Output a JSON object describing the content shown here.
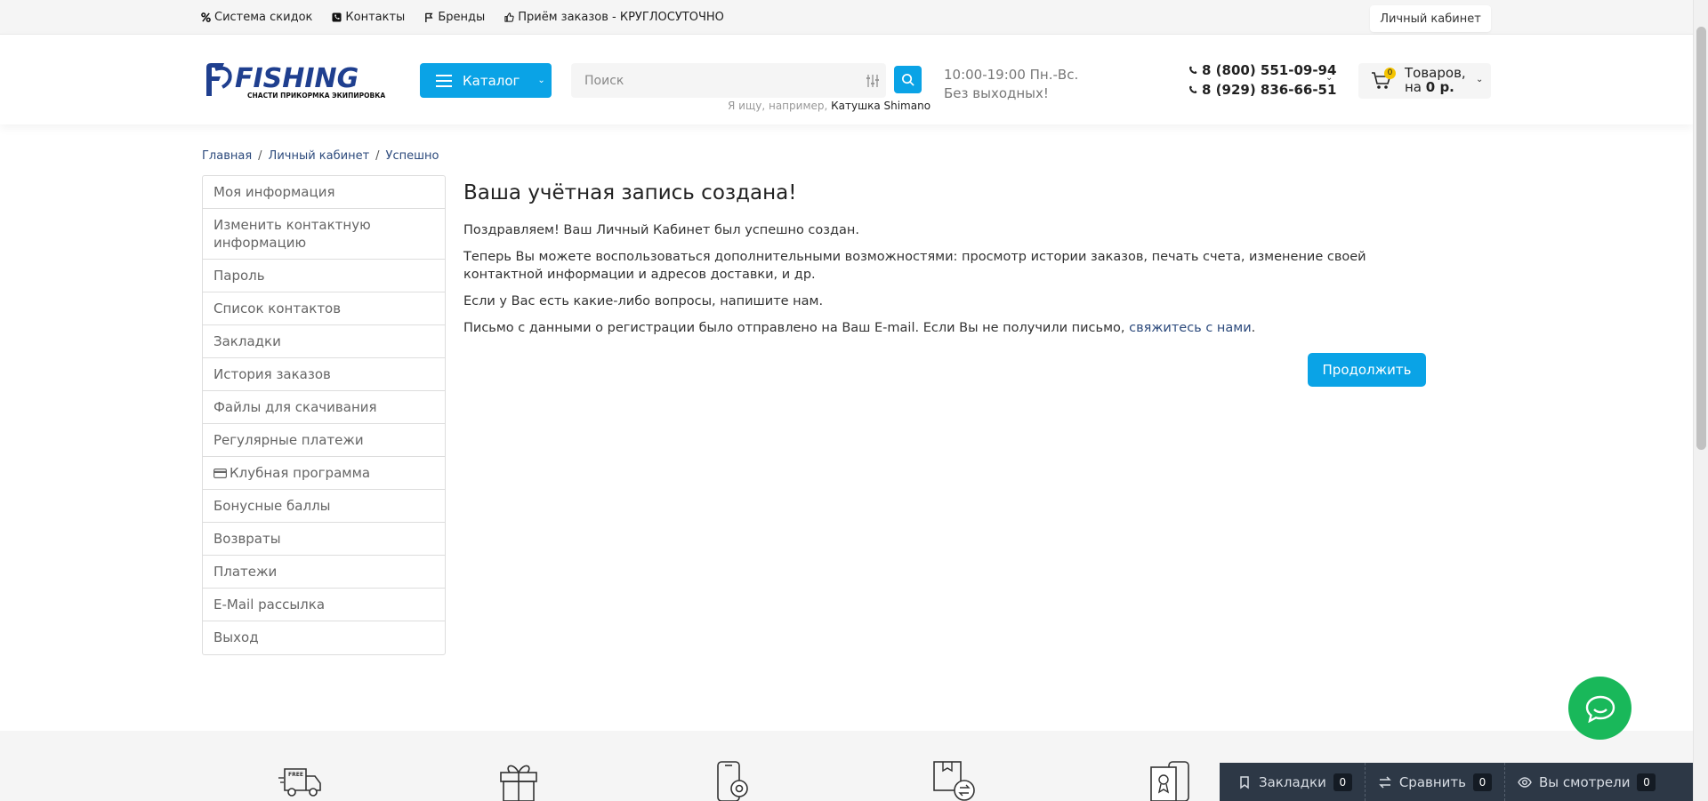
{
  "topbar": {
    "links": [
      {
        "label": "Система скидок",
        "icon": "percent-icon"
      },
      {
        "label": "Контакты",
        "icon": "phone-icon"
      },
      {
        "label": "Бренды",
        "icon": "flag-icon"
      },
      {
        "label": "Приём заказов - КРУГЛОСУТОЧНО",
        "icon": "thumbs-up-icon"
      }
    ],
    "cabinet_label": "Личный кабинет"
  },
  "header": {
    "logo_text": "FISHING",
    "logo_subtext": "СНАСТИ ПРИКОРМКА ЭКИПИРОВКА",
    "catalog_label": "Каталог",
    "search_placeholder": "Поиск",
    "search_hint_prefix": "Я ищу, например,",
    "search_hint_example": "Катушка Shimano",
    "hours_line1": "10:00-19:00 Пн.-Вс.",
    "hours_line2": "Без выходных!",
    "phone1": "8 (800) 551-09-94",
    "phone2": "8 (929) 836-66-51",
    "cart_count": "0",
    "cart_line1": "Товаров,",
    "cart_line2_prefix": "на",
    "cart_total": "0 р."
  },
  "breadcrumb": [
    "Главная",
    "Личный кабинет",
    "Успешно"
  ],
  "sidebar": {
    "items": [
      "Моя информация",
      "Изменить контактную информацию",
      "Пароль",
      "Список контактов",
      "Закладки",
      "История заказов",
      "Файлы для скачивания",
      "Регулярные платежи",
      "Клубная программа",
      "Бонусные баллы",
      "Возвраты",
      "Платежи",
      "E-Mail рассылка",
      "Выход"
    ]
  },
  "content": {
    "title": "Ваша учётная запись создана!",
    "p1": "Поздравляем! Ваш Личный Кабинет был успешно создан.",
    "p2": "Теперь Вы можете воспользоваться дополнительными возможностями: просмотр истории заказов, печать счета, изменение своей контактной информации и адресов доставки, и др.",
    "p3": "Если у Вас есть какие-либо вопросы, напишите нам.",
    "p4_prefix": "Письмо с данными о регистрации было отправлено на Ваш E-mail. Если Вы не получили письмо,",
    "p4_link": "свяжитесь с нами",
    "p4_suffix": ".",
    "continue_label": "Продолжить"
  },
  "features": {
    "icons": [
      "free-delivery-truck-icon",
      "gift-box-icon",
      "mobile-settings-icon",
      "exchange-box-icon",
      "certificate-phone-icon"
    ],
    "truck_badge": "FREE"
  },
  "bottombar": {
    "bookmarks_label": "Закладки",
    "bookmarks_count": "0",
    "compare_label": "Сравнить",
    "compare_count": "0",
    "viewed_label": "Вы смотрели",
    "viewed_count": "0"
  },
  "colors": {
    "accent": "#0aa3e6",
    "logo_blue": "#1f3f8f",
    "chat_green": "#19b85a",
    "bottombar_bg": "#2d3846",
    "badge_yellow": "#f5c400"
  }
}
